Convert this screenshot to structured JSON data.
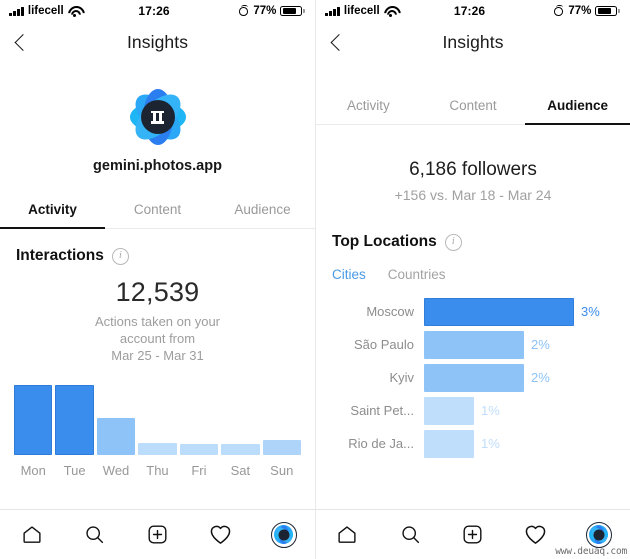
{
  "status_bar": {
    "carrier": "lifecell",
    "time": "17:26",
    "battery_percent": "77%",
    "signal_icon": "cellular-signal-icon",
    "wifi_icon": "wifi-icon",
    "alarm_icon": "alarm-clock-icon",
    "battery_icon": "battery-icon"
  },
  "left_screen": {
    "nav": {
      "back_icon": "back-chevron-icon",
      "title": "Insights"
    },
    "profile": {
      "username": "gemini.photos.app",
      "avatar_icon": "profile-avatar-gemini-flower"
    },
    "tabs": [
      {
        "label": "Activity",
        "active": true
      },
      {
        "label": "Content",
        "active": false
      },
      {
        "label": "Audience",
        "active": false
      }
    ],
    "interactions": {
      "title": "Interactions",
      "info_icon": "info-icon",
      "value": "12,539",
      "subtitle_line1": "Actions taken on your",
      "subtitle_line2": "account from",
      "subtitle_line3": "Mar 25 - Mar 31"
    },
    "chart_data": {
      "type": "bar",
      "title": "Interactions",
      "xlabel": "",
      "ylabel": "",
      "categories": [
        "Mon",
        "Tue",
        "Wed",
        "Thu",
        "Fri",
        "Sat",
        "Sun"
      ],
      "values": [
        70,
        70,
        37,
        12,
        11,
        11,
        15
      ],
      "ylim": [
        0,
        75
      ],
      "grid": false,
      "legend": "none",
      "bar_colors": [
        "#3b8ded",
        "#3b8ded",
        "#8dc3f7",
        "#bcdcfb",
        "#bcdcfb",
        "#bcdcfb",
        "#aed4fa"
      ]
    }
  },
  "right_screen": {
    "nav": {
      "back_icon": "back-chevron-icon",
      "title": "Insights"
    },
    "tabs": [
      {
        "label": "Activity",
        "active": false
      },
      {
        "label": "Content",
        "active": false
      },
      {
        "label": "Audience",
        "active": true
      }
    ],
    "followers": {
      "count": "6,186 followers",
      "delta": "+156 vs. Mar 18 - Mar 24"
    },
    "top_locations": {
      "title": "Top Locations",
      "info_icon": "info-icon",
      "subtabs": [
        {
          "label": "Cities",
          "active": true
        },
        {
          "label": "Countries",
          "active": false
        }
      ]
    },
    "chart_data": {
      "type": "bar",
      "orientation": "horizontal",
      "title": "Top Locations",
      "xlabel": "",
      "ylabel": "",
      "categories": [
        "Moscow",
        "São Paulo",
        "Kyiv",
        "Saint Pet...",
        "Rio de Ja..."
      ],
      "values": [
        3,
        2,
        2,
        1,
        1
      ],
      "value_labels": [
        "3%",
        "2%",
        "2%",
        "1%",
        "1%"
      ],
      "xlim": [
        0,
        3
      ],
      "grid": false,
      "legend": "none",
      "bar_colors": [
        "#3b8ded",
        "#8dc3f7",
        "#8dc3f7",
        "#bfdefc",
        "#bfdefc"
      ],
      "label_colors": [
        "#3b8ded",
        "#8dc3f7",
        "#8dc3f7",
        "#bfdefc",
        "#bfdefc"
      ]
    }
  },
  "tabbar": {
    "items": [
      {
        "icon": "home-icon"
      },
      {
        "icon": "search-icon"
      },
      {
        "icon": "add-post-icon"
      },
      {
        "icon": "activity-heart-icon"
      },
      {
        "icon": "profile-avatar-icon"
      }
    ]
  },
  "watermark": "www.deuaq.com",
  "colors": {
    "accent_blue": "#3b8ded",
    "light_blue": "#8dc3f7",
    "lightest_blue": "#bfdefc",
    "text_primary": "#111111",
    "text_muted": "#9a9a9a"
  }
}
